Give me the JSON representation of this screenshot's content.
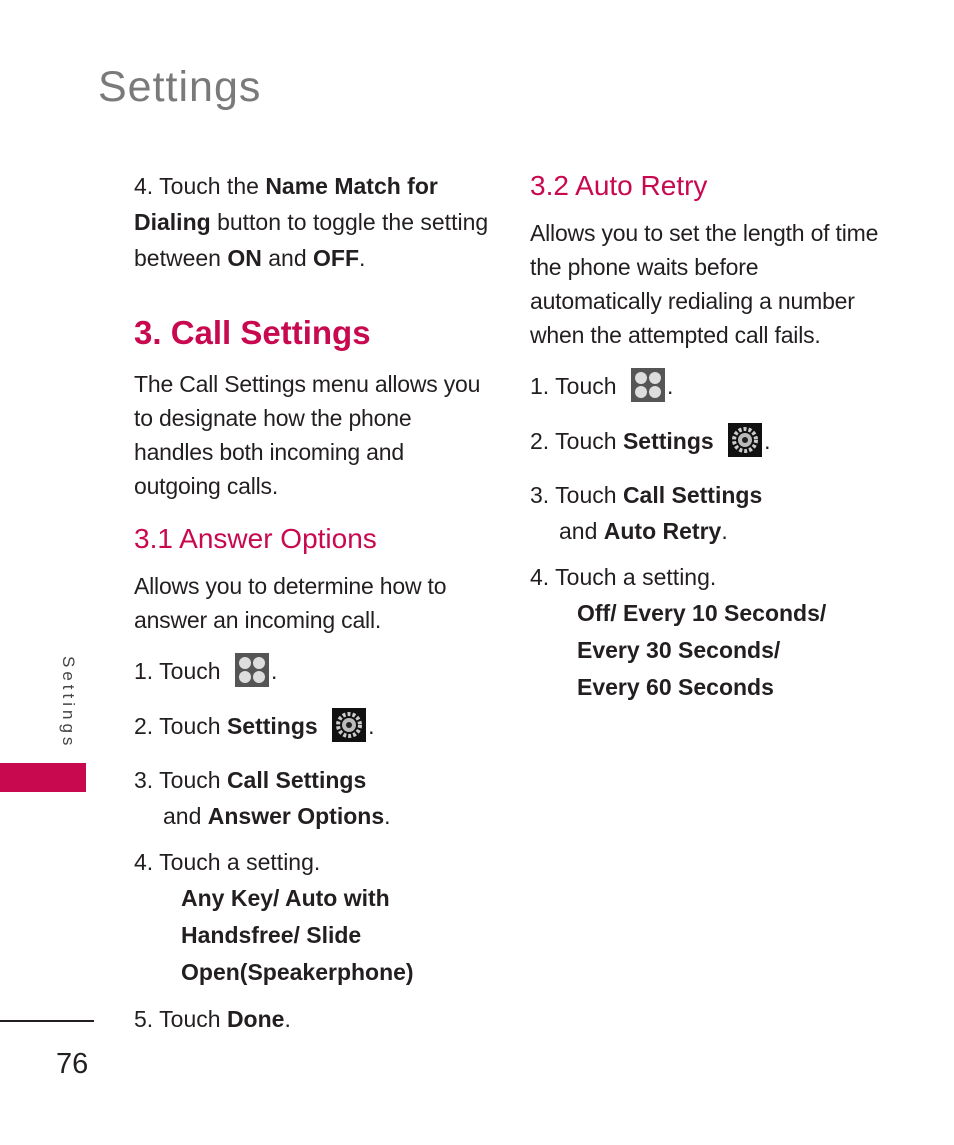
{
  "page": {
    "title": "Settings",
    "side_tab_label": "Settings",
    "page_number": "76",
    "accent_color": "#c8094f"
  },
  "left_column": {
    "intro_step": {
      "num": "4.",
      "pre": "Touch the",
      "bold1": "Name Match for Dialing",
      "mid": "button to toggle the setting between",
      "bold2": "ON",
      "and": "and",
      "bold3": "OFF",
      "end": "."
    },
    "section_heading": "3. Call Settings",
    "section_body": "The Call Settings menu allows you to designate how the phone handles both incoming and outgoing calls.",
    "subsection": {
      "heading": "3.1 Answer Options",
      "body": "Allows you to determine how to answer an incoming call.",
      "steps": [
        {
          "num": "1.",
          "text": "Touch",
          "icon": "apps-grid-icon",
          "end": "."
        },
        {
          "num": "2.",
          "text": "Touch",
          "bold": "Settings",
          "icon": "settings-gear-icon",
          "end": "."
        },
        {
          "num": "3.",
          "text": "Touch",
          "bold": "Call Settings",
          "and": "and",
          "bold2": "Answer Options",
          "end": "."
        },
        {
          "num": "4.",
          "text": "Touch a setting."
        },
        {
          "num": "5.",
          "text": "Touch",
          "bold": "Done",
          "end": "."
        }
      ],
      "options_lines": [
        "Any Key/ Auto with",
        "Handsfree/ Slide",
        "Open(Speakerphone)"
      ]
    }
  },
  "right_column": {
    "subsection": {
      "heading": "3.2 Auto Retry",
      "body": "Allows you to set the length of time the phone waits before automatically redialing a number when the attempted call fails.",
      "steps": [
        {
          "num": "1.",
          "text": "Touch",
          "icon": "apps-grid-icon",
          "end": "."
        },
        {
          "num": "2.",
          "text": "Touch",
          "bold": "Settings",
          "icon": "settings-gear-icon",
          "end": "."
        },
        {
          "num": "3.",
          "text": "Touch",
          "bold": "Call Settings",
          "and": "and",
          "bold2": "Auto Retry",
          "end": "."
        },
        {
          "num": "4.",
          "text": "Touch a setting."
        }
      ],
      "options_lines": [
        "Off/ Every 10 Seconds/",
        "Every 30 Seconds/",
        "Every 60 Seconds"
      ]
    }
  }
}
